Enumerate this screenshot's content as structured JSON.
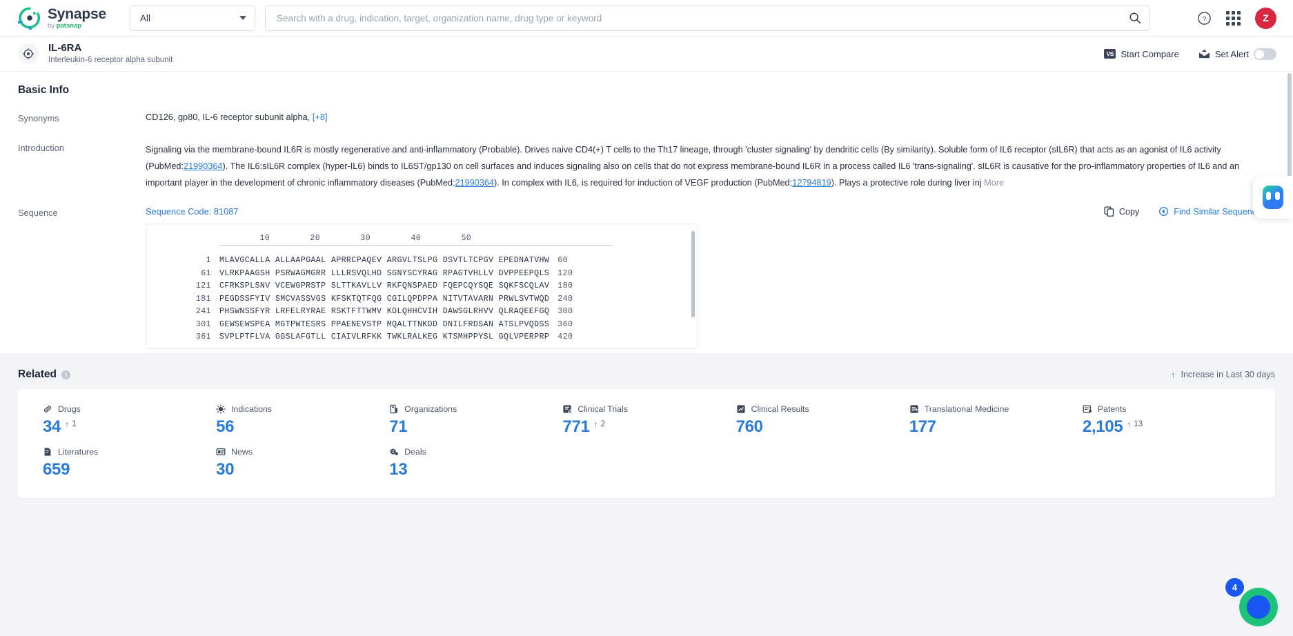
{
  "topbar": {
    "brand": "Synapse",
    "brand_sub_prefix": "by ",
    "brand_sub_name": "patsnap",
    "scope_value": "All",
    "scope_options": [
      "All"
    ],
    "search_placeholder": "Search with a drug, indication, target, organization name, drug type or keyword",
    "search_value": "",
    "help_icon": "question-circle-icon",
    "apps_icon": "grid-apps-icon",
    "avatar_initial": "Z",
    "avatar_color": "#d7263d"
  },
  "entity": {
    "icon": "target-crosshair-icon",
    "title": "IL-6RA",
    "subtitle": "Interleukin-6 receptor alpha subunit",
    "compare_label": "Start Compare",
    "compare_icon_text": "VS",
    "alert_label": "Set Alert",
    "alert_icon": "mail-alert-icon",
    "alert_toggle_on": false
  },
  "basic_info": {
    "heading": "Basic Info",
    "synonyms_label": "Synonyms",
    "synonyms_value": "CD126,  gp80,  IL-6 receptor subunit alpha,",
    "synonyms_more": "[+8]",
    "introduction_label": "Introduction",
    "introduction_parts": [
      "Signaling via the membrane-bound IL6R is mostly regenerative and anti-inflammatory (Probable). Drives naive CD4(+) T cells to the Th17 lineage, through 'cluster signaling' by dendritic cells (By similarity). Soluble form of IL6 receptor (sIL6R) that acts as an agonist of IL6 activity (PubMed:",
      "21990364",
      "). The IL6:sIL6R complex (hyper-IL6) binds to IL6ST/gp130 on cell surfaces and induces signaling also on cells that do not express membrane-bound IL6R in a process called IL6 'trans-signaling'. sIL6R is causative for the pro-inflammatory properties of IL6 and an important player in the development of chronic inflammatory diseases (PubMed:",
      "21990364",
      "). In complex with IL6, is required for induction of VEGF production (PubMed:",
      "12794819",
      "). Plays a protective role during liver inj"
    ],
    "introduction_more": "More"
  },
  "sequence": {
    "label": "Sequence",
    "code_label": "Sequence Code: 81087",
    "copy_label": "Copy",
    "copy_icon": "copy-icon",
    "find_label": "Find Similar Sequence",
    "find_icon": "similar-sequence-icon",
    "ruler": [
      "10",
      "20",
      "30",
      "40",
      "50"
    ],
    "rows": [
      {
        "start": "1",
        "blocks": [
          "MLAVGCALLA",
          "ALLAAPGAAL",
          "APRRCPAQEV",
          "ARGVLTSLPG",
          "DSVTLTCPGV",
          "EPEDNATVHW"
        ],
        "end": "60"
      },
      {
        "start": "61",
        "blocks": [
          "VLRKPAAGSH",
          "PSRWAGMGRR",
          "LLLRSVQLHD",
          "SGNYSCYRAG",
          "RPAGTVHLLV",
          "DVPPEEPQLS"
        ],
        "end": "120"
      },
      {
        "start": "121",
        "blocks": [
          "CFRKSPLSNV",
          "VCEWGPRSTP",
          "SLTTKAVLLV",
          "RKFQNSPAED",
          "FQEPCQYSQE",
          "SQKFSCQLAV"
        ],
        "end": "180"
      },
      {
        "start": "181",
        "blocks": [
          "PEGDSSFYIV",
          "SMCVASSVGS",
          "KFSKTQTFQG",
          "CGILQPDPPA",
          "NITVTAVARN",
          "PRWLSVTWQD"
        ],
        "end": "240"
      },
      {
        "start": "241",
        "blocks": [
          "PHSWNSSFYR",
          "LRFELRYRAE",
          "RSKTFTTWMV",
          "KDLQHHCVIH",
          "DAWSGLRHVV",
          "QLRAQEEFGQ"
        ],
        "end": "300"
      },
      {
        "start": "301",
        "blocks": [
          "GEWSEWSPEA",
          "MGTPWTESRS",
          "PPAENEVSTP",
          "MQALTTNKDD",
          "DNILFRDSAN",
          "ATSLPVQDSS"
        ],
        "end": "360"
      },
      {
        "start": "361",
        "blocks": [
          "SVPLPTFLVA",
          "GGSLAFGTLL",
          "CIAIVLRFKK",
          "TWKLRALKEG",
          "KTSMHPPYSL",
          "GQLVPERPRP"
        ],
        "end": "420"
      }
    ]
  },
  "related": {
    "heading": "Related",
    "info_icon": "info-icon",
    "increase_note": "Increase in Last 30 days",
    "increase_arrow": "↑",
    "stats": [
      {
        "label": "Drugs",
        "icon": "capsule-icon",
        "value": "34",
        "delta": "1"
      },
      {
        "label": "Indications",
        "icon": "virus-icon",
        "value": "56",
        "delta": ""
      },
      {
        "label": "Organizations",
        "icon": "building-icon",
        "value": "71",
        "delta": ""
      },
      {
        "label": "Clinical Trials",
        "icon": "clinical-trial-icon",
        "value": "771",
        "delta": "2"
      },
      {
        "label": "Clinical Results",
        "icon": "clinical-result-icon",
        "value": "760",
        "delta": ""
      },
      {
        "label": "Translational Medicine",
        "icon": "translational-medicine-icon",
        "value": "177",
        "delta": ""
      },
      {
        "label": "Patents",
        "icon": "patent-icon",
        "value": "2,105",
        "delta": "13"
      },
      {
        "label": "Literatures",
        "icon": "literature-icon",
        "value": "659",
        "delta": ""
      },
      {
        "label": "News",
        "icon": "news-icon",
        "value": "30",
        "delta": ""
      },
      {
        "label": "Deals",
        "icon": "deal-icon",
        "value": "13",
        "delta": ""
      }
    ]
  },
  "floating": {
    "ai_assistant_icon": "ai-assistant-icon",
    "fab_icon": "support-chat-icon",
    "fab_badge": "4"
  },
  "colors": {
    "accent_blue": "#2a7bd6",
    "green": "#2aa85c",
    "avatar_red": "#d7263d"
  }
}
